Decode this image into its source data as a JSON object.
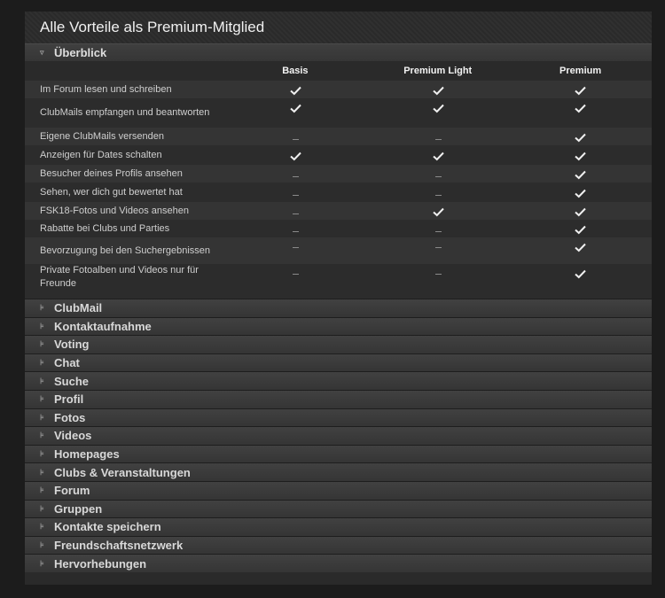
{
  "title": "Alle Vorteile als Premium-Mitglied",
  "overview": {
    "label": "Überblick",
    "columns": [
      "Basis",
      "Premium Light",
      "Premium"
    ],
    "rows": [
      {
        "label": "Im Forum lesen und schreiben",
        "values": [
          true,
          true,
          true
        ]
      },
      {
        "label": "ClubMails empfangen und beantworten",
        "values": [
          true,
          true,
          true
        ]
      },
      {
        "label": "Eigene ClubMails versenden",
        "values": [
          false,
          false,
          true
        ]
      },
      {
        "label": "Anzeigen für Dates schalten",
        "values": [
          true,
          true,
          true
        ]
      },
      {
        "label": "Besucher deines Profils ansehen",
        "values": [
          false,
          false,
          true
        ]
      },
      {
        "label": "Sehen, wer dich gut bewertet hat",
        "values": [
          false,
          false,
          true
        ]
      },
      {
        "label": "FSK18-Fotos und Videos ansehen",
        "values": [
          false,
          true,
          true
        ]
      },
      {
        "label": "Rabatte bei Clubs und Parties",
        "values": [
          false,
          false,
          true
        ]
      },
      {
        "label": "Bevorzugung bei den Suchergebnissen",
        "values": [
          false,
          false,
          true
        ]
      },
      {
        "label": "Private Fotoalben und Videos nur für Freunde",
        "values": [
          false,
          false,
          true
        ]
      }
    ]
  },
  "sections": [
    "ClubMail",
    "Kontaktaufnahme",
    "Voting",
    "Chat",
    "Suche",
    "Profil",
    "Fotos",
    "Videos",
    "Homepages",
    "Clubs & Veranstaltungen",
    "Forum",
    "Gruppen",
    "Kontakte speichern",
    "Freundschaftsnetzwerk",
    "Hervorhebungen"
  ],
  "icons": {
    "expanded": "caret-down-icon",
    "collapsed": "expand-arrow-icon",
    "check": "check-icon",
    "dash": "dash-icon"
  },
  "colors": {
    "background": "#1c1c1c",
    "panel": "#2a2a2a",
    "check": "#f0f0f0"
  }
}
